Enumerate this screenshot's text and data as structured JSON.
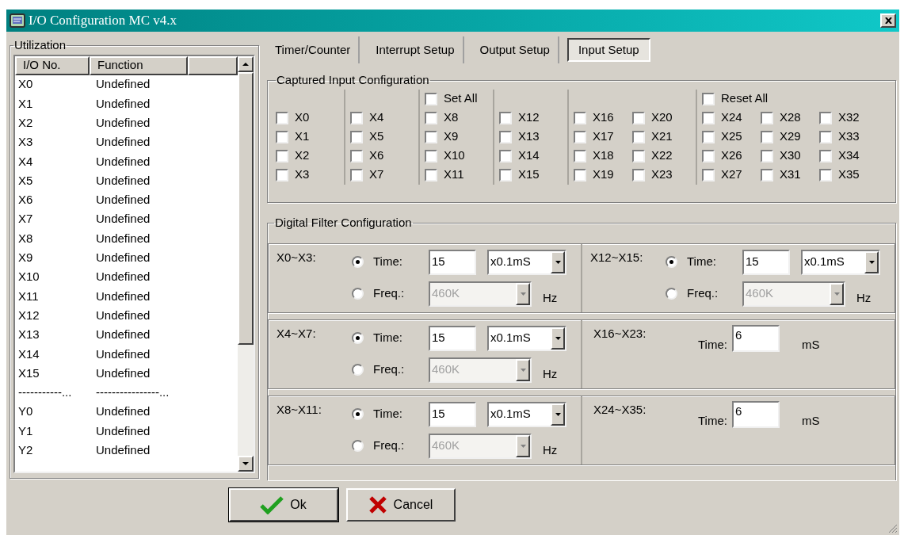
{
  "window": {
    "title": "I/O Configuration MC v4.x"
  },
  "utilization": {
    "title": "Utilization",
    "columns": [
      "I/O No.",
      "Function"
    ],
    "rows": [
      {
        "io": "X0",
        "function": "Undefined"
      },
      {
        "io": "X1",
        "function": "Undefined"
      },
      {
        "io": "X2",
        "function": "Undefined"
      },
      {
        "io": "X3",
        "function": "Undefined"
      },
      {
        "io": "X4",
        "function": "Undefined"
      },
      {
        "io": "X5",
        "function": "Undefined"
      },
      {
        "io": "X6",
        "function": "Undefined"
      },
      {
        "io": "X7",
        "function": "Undefined"
      },
      {
        "io": "X8",
        "function": "Undefined"
      },
      {
        "io": "X9",
        "function": "Undefined"
      },
      {
        "io": "X10",
        "function": "Undefined"
      },
      {
        "io": "X11",
        "function": "Undefined"
      },
      {
        "io": "X12",
        "function": "Undefined"
      },
      {
        "io": "X13",
        "function": "Undefined"
      },
      {
        "io": "X14",
        "function": "Undefined"
      },
      {
        "io": "X15",
        "function": "Undefined"
      },
      {
        "io": "-----------...",
        "function": "----------------..."
      },
      {
        "io": "Y0",
        "function": "Undefined"
      },
      {
        "io": "Y1",
        "function": "Undefined"
      },
      {
        "io": "Y2",
        "function": "Undefined"
      }
    ]
  },
  "tabs": [
    {
      "label": "Timer/Counter",
      "selected": false
    },
    {
      "label": "Interrupt Setup",
      "selected": false
    },
    {
      "label": "Output Setup",
      "selected": false
    },
    {
      "label": "Input Setup",
      "selected": true
    }
  ],
  "captured": {
    "title": "Captured Input Configuration",
    "groups": [
      {
        "inputs": [
          {
            "label": "X0",
            "checked": false
          },
          {
            "label": "X1",
            "checked": false
          },
          {
            "label": "X2",
            "checked": false
          },
          {
            "label": "X3",
            "checked": false
          }
        ]
      },
      {
        "inputs": [
          {
            "label": "X4",
            "checked": false
          },
          {
            "label": "X5",
            "checked": false
          },
          {
            "label": "X6",
            "checked": false
          },
          {
            "label": "X7",
            "checked": false
          }
        ]
      },
      {
        "header": {
          "label": "Set All",
          "checked": false
        },
        "inputs": [
          {
            "label": "X8",
            "checked": false
          },
          {
            "label": "X9",
            "checked": false
          },
          {
            "label": "X10",
            "checked": false
          },
          {
            "label": "X11",
            "checked": false
          }
        ]
      },
      {
        "inputs": [
          {
            "label": "X12",
            "checked": false
          },
          {
            "label": "X13",
            "checked": false
          },
          {
            "label": "X14",
            "checked": false
          },
          {
            "label": "X15",
            "checked": false
          }
        ]
      },
      {
        "inputs": [
          {
            "label": "X16",
            "checked": false
          },
          {
            "label": "X17",
            "checked": false
          },
          {
            "label": "X18",
            "checked": false
          },
          {
            "label": "X19",
            "checked": false
          },
          {
            "label": "X20",
            "checked": false
          },
          {
            "label": "X21",
            "checked": false
          },
          {
            "label": "X22",
            "checked": false
          },
          {
            "label": "X23",
            "checked": false
          }
        ]
      },
      {
        "header": {
          "label": "Reset All",
          "checked": false
        },
        "inputs": [
          {
            "label": "X24",
            "checked": false
          },
          {
            "label": "X25",
            "checked": false
          },
          {
            "label": "X26",
            "checked": false
          },
          {
            "label": "X27",
            "checked": false
          },
          {
            "label": "X28",
            "checked": false
          },
          {
            "label": "X29",
            "checked": false
          },
          {
            "label": "X30",
            "checked": false
          },
          {
            "label": "X31",
            "checked": false
          },
          {
            "label": "X32",
            "checked": false
          },
          {
            "label": "X33",
            "checked": false
          },
          {
            "label": "X34",
            "checked": false
          },
          {
            "label": "X35",
            "checked": false
          }
        ]
      }
    ]
  },
  "filter": {
    "title": "Digital Filter Configuration",
    "rows": [
      {
        "panels": [
          {
            "kind": "time_freq",
            "label": "X0~X3:",
            "time_label": "Time:",
            "time_selected": true,
            "time_value": "15",
            "unit": "x0.1mS",
            "freq_label": "Freq.:",
            "freq_selected": false,
            "freq_value": "460K",
            "freq_unit": "Hz"
          },
          {
            "kind": "time_freq",
            "label": "X12~X15:",
            "time_label": "Time:",
            "time_selected": true,
            "time_value": "15",
            "unit": "x0.1mS",
            "freq_label": "Freq.:",
            "freq_selected": false,
            "freq_value": "460K",
            "freq_unit": "Hz"
          }
        ]
      },
      {
        "panels": [
          {
            "kind": "time_freq",
            "label": "X4~X7:",
            "time_label": "Time:",
            "time_selected": true,
            "time_value": "15",
            "unit": "x0.1mS",
            "freq_label": "Freq.:",
            "freq_selected": false,
            "freq_value": "460K",
            "freq_unit": "Hz"
          },
          {
            "kind": "time_only",
            "label": "X16~X23:",
            "time_label": "Time:",
            "time_value": "6",
            "unit": "mS"
          }
        ]
      },
      {
        "panels": [
          {
            "kind": "time_freq",
            "label": "X8~X11:",
            "time_label": "Time:",
            "time_selected": true,
            "time_value": "15",
            "unit": "x0.1mS",
            "freq_label": "Freq.:",
            "freq_selected": false,
            "freq_value": "460K",
            "freq_unit": "Hz"
          },
          {
            "kind": "time_only",
            "label": "X24~X35:",
            "time_label": "Time:",
            "time_value": "6",
            "unit": "mS"
          }
        ]
      }
    ]
  },
  "buttons": [
    {
      "kind": "ok",
      "label": "Ok"
    },
    {
      "kind": "cancel",
      "label": "Cancel"
    }
  ]
}
